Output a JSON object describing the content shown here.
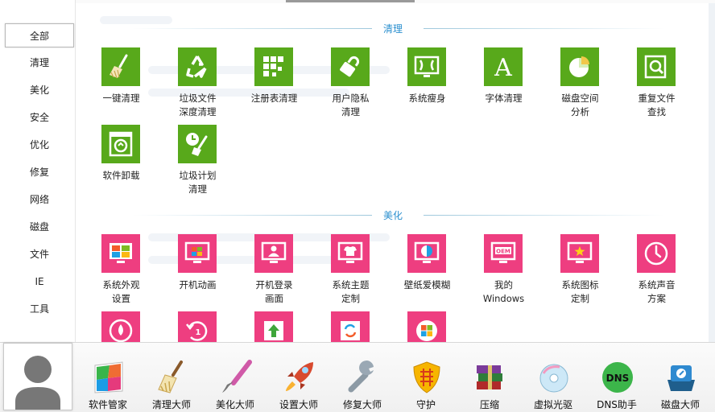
{
  "sidebar": {
    "items": [
      {
        "label": "全部"
      },
      {
        "label": "清理"
      },
      {
        "label": "美化"
      },
      {
        "label": "安全"
      },
      {
        "label": "优化"
      },
      {
        "label": "修复"
      },
      {
        "label": "网络"
      },
      {
        "label": "磁盘"
      },
      {
        "label": "文件"
      },
      {
        "label": "IE"
      },
      {
        "label": "工具"
      }
    ],
    "active": "全部"
  },
  "sections": {
    "clean": {
      "title": "清理",
      "tiles": [
        {
          "label": "一键清理",
          "icon": "broom-icon"
        },
        {
          "label": "垃圾文件\n深度清理",
          "icon": "recycle-icon"
        },
        {
          "label": "注册表清理",
          "icon": "registry-grid-icon"
        },
        {
          "label": "用户隐私\n清理",
          "icon": "privacy-lock-icon"
        },
        {
          "label": "系统瘦身",
          "icon": "slim-screen-icon"
        },
        {
          "label": "字体清理",
          "icon": "font-icon"
        },
        {
          "label": "磁盘空间\n分析",
          "icon": "pie-chart-icon"
        },
        {
          "label": "重复文件\n查找",
          "icon": "duplicate-file-icon"
        },
        {
          "label": "软件卸载",
          "icon": "uninstall-bin-icon"
        },
        {
          "label": "垃圾计划\n清理",
          "icon": "scheduled-clean-icon"
        }
      ]
    },
    "beautify": {
      "title": "美化",
      "tiles": [
        {
          "label": "系统外观\n设置",
          "icon": "appearance-icon"
        },
        {
          "label": "开机动画",
          "icon": "boot-animation-icon"
        },
        {
          "label": "开机登录\n画面",
          "icon": "login-screen-icon"
        },
        {
          "label": "系统主题\n定制",
          "icon": "theme-shirt-icon"
        },
        {
          "label": "壁纸爱模糊",
          "icon": "wallpaper-icon"
        },
        {
          "label": "我的\nWindows",
          "icon": "oem-icon"
        },
        {
          "label": "系统图标\n定制",
          "icon": "star-monitor-icon"
        },
        {
          "label": "系统声音\n方案",
          "icon": "sound-clock-icon"
        },
        {
          "label": "",
          "icon": "drop-icon"
        },
        {
          "label": "",
          "icon": "restore-icon"
        },
        {
          "label": "",
          "icon": "upload-arrow-icon"
        },
        {
          "label": "",
          "icon": "refresh-icon"
        },
        {
          "label": "",
          "icon": "windows-logo-icon"
        }
      ]
    }
  },
  "dock": {
    "items": [
      {
        "label": "软件管家",
        "icon": "software-manager-icon"
      },
      {
        "label": "清理大师",
        "icon": "cleaning-brush-icon"
      },
      {
        "label": "美化大师",
        "icon": "paint-brush-icon"
      },
      {
        "label": "设置大师",
        "icon": "rocket-icon"
      },
      {
        "label": "修复大师",
        "icon": "wrench-icon"
      },
      {
        "label": "守护",
        "icon": "shield-icon"
      },
      {
        "label": "压缩",
        "icon": "books-icon"
      },
      {
        "label": "虚拟光驱",
        "icon": "disc-icon"
      },
      {
        "label": "DNS助手",
        "icon": "dns-icon"
      },
      {
        "label": "磁盘大师",
        "icon": "disk-icon"
      }
    ]
  },
  "colors": {
    "green_tile": "#58a91b",
    "pink_tile": "#ee3e80",
    "section_title": "#2a8fcf"
  }
}
